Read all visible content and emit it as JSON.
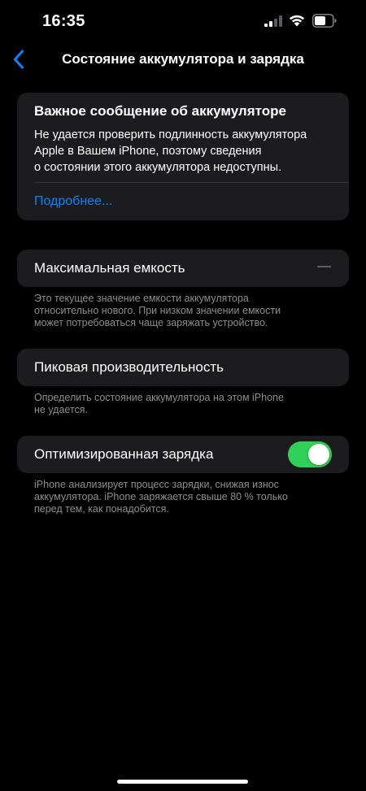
{
  "status_bar": {
    "time": "16:35",
    "icons": [
      "cellular-signal-icon",
      "wifi-icon",
      "battery-icon"
    ]
  },
  "nav": {
    "title": "Состояние аккумулятора и зарядка",
    "back_icon": "chevron-left-icon"
  },
  "message_card": {
    "title": "Важное сообщение об аккумуляторе",
    "body_lines": [
      "Не удается проверить подлинность аккумулятора",
      "Apple в Вашем iPhone, поэтому сведения",
      "о состоянии этого аккумулятора недоступны."
    ],
    "link": "Подробнее..."
  },
  "max_capacity": {
    "label": "Максимальная емкость",
    "value": "—",
    "footnote_lines": [
      "Это текущее значение емкости аккумулятора",
      "относительно нового. При низком значении емкости",
      "может потребоваться чаще заряжать устройство."
    ]
  },
  "peak_performance": {
    "label": "Пиковая производительность",
    "footnote_lines": [
      "Определить состояние аккумулятора на этом iPhone",
      "не удается."
    ]
  },
  "optimized_charging": {
    "label": "Оптимизированная зарядка",
    "enabled": true,
    "footnote_lines": [
      "iPhone анализирует процесс зарядки, снижая износ",
      "аккумулятора. iPhone заряжается свыше 80 % только",
      "перед тем, как понадобится."
    ]
  },
  "colors": {
    "background": "#000000",
    "card": "#1c1c1e",
    "accent_link": "#0a84ff",
    "toggle_on": "#30d158",
    "secondary_text": "#8d8d92"
  }
}
